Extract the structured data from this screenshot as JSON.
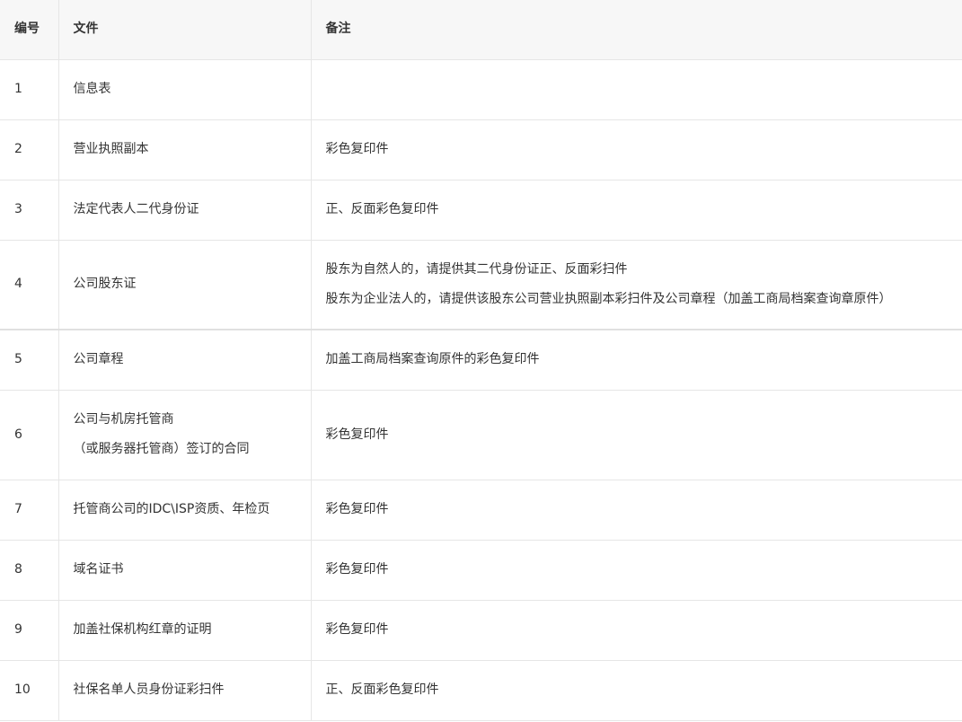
{
  "table": {
    "headers": {
      "num": "编号",
      "file": "文件",
      "note": "备注"
    },
    "rows": [
      {
        "num": "1",
        "file": [
          "信息表"
        ],
        "note": []
      },
      {
        "num": "2",
        "file": [
          "营业执照副本"
        ],
        "note": [
          "彩色复印件"
        ]
      },
      {
        "num": "3",
        "file": [
          "法定代表人二代身份证"
        ],
        "note": [
          "正、反面彩色复印件"
        ]
      },
      {
        "num": "4",
        "file": [
          "公司股东证"
        ],
        "note": [
          "股东为自然人的，请提供其二代身份证正、反面彩扫件",
          "股东为企业法人的，请提供该股东公司营业执照副本彩扫件及公司章程（加盖工商局档案查询章原件）"
        ]
      },
      {
        "num": "5",
        "file": [
          "公司章程"
        ],
        "note": [
          "加盖工商局档案查询原件的彩色复印件"
        ]
      },
      {
        "num": "6",
        "file": [
          "公司与机房托管商",
          "（或服务器托管商）签订的合同"
        ],
        "note": [
          "彩色复印件"
        ]
      },
      {
        "num": "7",
        "file": [
          "托管商公司的IDC\\ISP资质、年检页"
        ],
        "note": [
          "彩色复印件"
        ]
      },
      {
        "num": "8",
        "file": [
          "域名证书"
        ],
        "note": [
          "彩色复印件"
        ]
      },
      {
        "num": "9",
        "file": [
          "加盖社保机构红章的证明"
        ],
        "note": [
          "彩色复印件"
        ]
      },
      {
        "num": "10",
        "file": [
          "社保名单人员身份证彩扫件"
        ],
        "note": [
          "正、反面彩色复印件"
        ]
      }
    ]
  }
}
